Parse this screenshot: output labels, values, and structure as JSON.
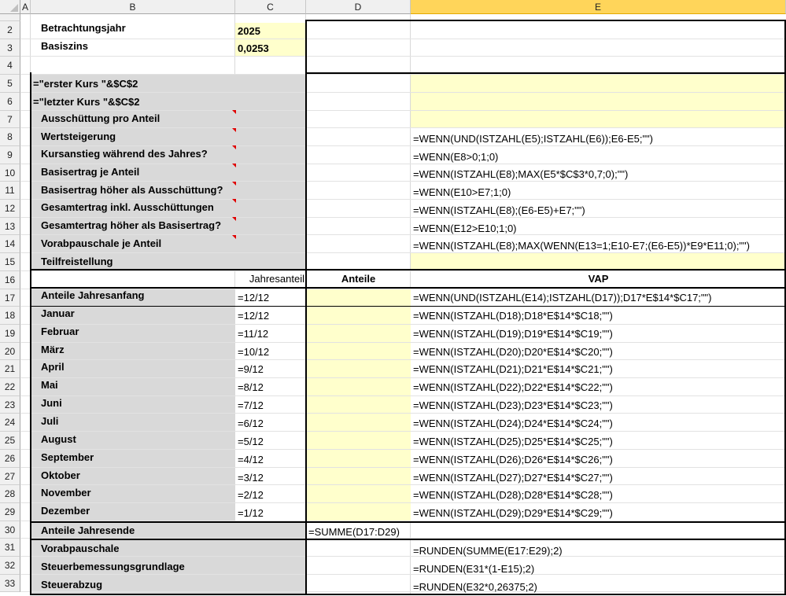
{
  "columns": [
    "A",
    "B",
    "C",
    "D",
    "E"
  ],
  "selected_column": "E",
  "rows": [
    "2",
    "3",
    "4",
    "5",
    "6",
    "7",
    "8",
    "9",
    "10",
    "11",
    "12",
    "13",
    "14",
    "15",
    "16",
    "17",
    "18",
    "19",
    "20",
    "21",
    "22",
    "23",
    "24",
    "25",
    "26",
    "27",
    "28",
    "29",
    "30",
    "31",
    "32",
    "33"
  ],
  "header": {
    "betrachtungsjahr_label": "Betrachtungsjahr",
    "betrachtungsjahr_value": "2025",
    "basiszins_label": "Basiszins",
    "basiszins_value": "0,0253"
  },
  "labels": {
    "r5": "=\"erster Kurs \"&$C$2",
    "r6": "=\"letzter Kurs \"&$C$2",
    "r7": "Ausschüttung pro Anteil",
    "r8": "Wertsteigerung",
    "r9": "Kursanstieg während des Jahres?",
    "r10": "Basisertrag je Anteil",
    "r11": "Basisertrag höher als Ausschüttung?",
    "r12": "Gesamtertrag inkl. Ausschüttungen",
    "r13": "Gesamtertrag höher als Basisertrag?",
    "r14": "Vorabpauschale je Anteil",
    "r15": "Teilfreistellung"
  },
  "formulas_top": {
    "r8": "=WENN(UND(ISTZAHL(E5);ISTZAHL(E6));E6-E5;\"\")",
    "r9": "=WENN(E8>0;1;0)",
    "r10": "=WENN(ISTZAHL(E8);MAX(E5*$C$3*0,7;0);\"\")",
    "r11": "=WENN(E10>E7;1;0)",
    "r12": "=WENN(ISTZAHL(E8);(E6-E5)+E7;\"\")",
    "r13": "=WENN(E12>E10;1;0)",
    "r14": "=WENN(ISTZAHL(E8);MAX(WENN(E13=1;E10-E7;(E6-E5))*E9*E11;0);\"\")"
  },
  "table_header": {
    "jahresanteil": "Jahresanteil",
    "anteile": "Anteile",
    "vap": "VAP"
  },
  "months": [
    {
      "label": "Anteile Jahresanfang",
      "share": "=12/12",
      "formula": "=WENN(UND(ISTZAHL(E14);ISTZAHL(D17));D17*E$14*$C17;\"\")"
    },
    {
      "label": "Januar",
      "share": "=12/12",
      "formula": "=WENN(ISTZAHL(D18);D18*E$14*$C18;\"\")"
    },
    {
      "label": "Februar",
      "share": "=11/12",
      "formula": "=WENN(ISTZAHL(D19);D19*E$14*$C19;\"\")"
    },
    {
      "label": "März",
      "share": "=10/12",
      "formula": "=WENN(ISTZAHL(D20);D20*E$14*$C20;\"\")"
    },
    {
      "label": "April",
      "share": "=9/12",
      "formula": "=WENN(ISTZAHL(D21);D21*E$14*$C21;\"\")"
    },
    {
      "label": "Mai",
      "share": "=8/12",
      "formula": "=WENN(ISTZAHL(D22);D22*E$14*$C22;\"\")"
    },
    {
      "label": "Juni",
      "share": "=7/12",
      "formula": "=WENN(ISTZAHL(D23);D23*E$14*$C23;\"\")"
    },
    {
      "label": "Juli",
      "share": "=6/12",
      "formula": "=WENN(ISTZAHL(D24);D24*E$14*$C24;\"\")"
    },
    {
      "label": "August",
      "share": "=5/12",
      "formula": "=WENN(ISTZAHL(D25);D25*E$14*$C25;\"\")"
    },
    {
      "label": "September",
      "share": "=4/12",
      "formula": "=WENN(ISTZAHL(D26);D26*E$14*$C26;\"\")"
    },
    {
      "label": "Oktober",
      "share": "=3/12",
      "formula": "=WENN(ISTZAHL(D27);D27*E$14*$C27;\"\")"
    },
    {
      "label": "November",
      "share": "=2/12",
      "formula": "=WENN(ISTZAHL(D28);D28*E$14*$C28;\"\")"
    },
    {
      "label": "Dezember",
      "share": "=1/12",
      "formula": "=WENN(ISTZAHL(D29);D29*E$14*$C29;\"\")"
    }
  ],
  "jahresende": {
    "label": "Anteile Jahresende",
    "formula": "=SUMME(D17:D29)"
  },
  "bottom": [
    {
      "label": "Vorabpauschale",
      "formula": "=RUNDEN(SUMME(E17:E29);2)"
    },
    {
      "label": "Steuerbemessungsgrundlage",
      "formula": "=RUNDEN(E31*(1-E15);2)"
    },
    {
      "label": "Steuerabzug",
      "formula": "=RUNDEN(E32*0,26375;2)"
    }
  ],
  "colors": {
    "yellow_fill": "#ffffcc",
    "gray_fill": "#d9d9d9",
    "comment_marker": "#e00000",
    "selected_header": "#ffd55a"
  }
}
